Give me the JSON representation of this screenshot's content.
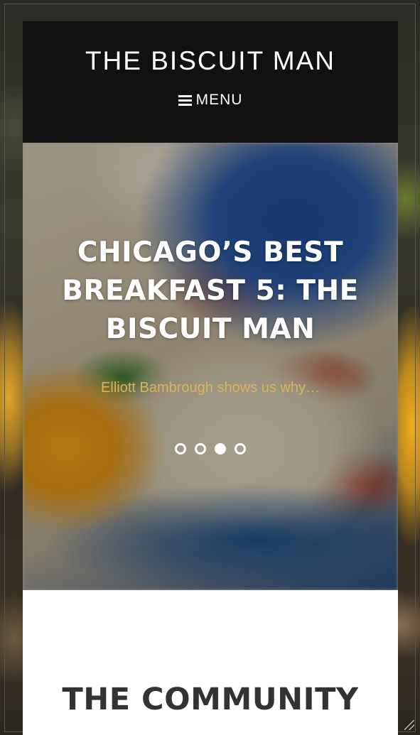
{
  "site": {
    "title": "THE BISCUIT MAN"
  },
  "nav": {
    "menu_label": "MENU",
    "menu_icon": "hamburger-icon"
  },
  "hero": {
    "title": "CHICAGO’S BEST BREAKFAST 5: THE BISCUIT MAN",
    "subtitle": "Elliott Bambrough shows us why…",
    "slides": [
      {
        "active": false
      },
      {
        "active": false
      },
      {
        "active": true
      },
      {
        "active": false
      }
    ]
  },
  "community": {
    "heading": "THE COMMUNITY"
  },
  "colors": {
    "masthead_bg": "#111111",
    "subtitle_gold": "#d9b45a",
    "heading_dark": "#333333"
  }
}
